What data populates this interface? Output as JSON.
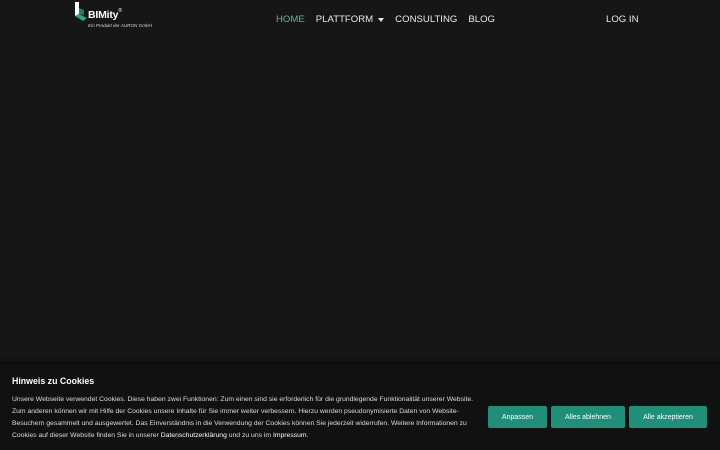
{
  "header": {
    "logo": {
      "name": "BIMity",
      "trademark": "®",
      "tagline": "Ein Produkt der AURON GmbH"
    },
    "nav": [
      {
        "label": "HOME",
        "active": true
      },
      {
        "label": "PLATTFORM",
        "has_dropdown": true
      },
      {
        "label": "CONSULTING"
      },
      {
        "label": "BLOG"
      }
    ],
    "login_label": "LOG IN"
  },
  "cookie_banner": {
    "title": "Hinweis zu Cookies",
    "text_main": "Unsere Webseite verwendet Cookies. Diese haben zwei Funktionen: Zum einen sind sie erforderlich für die grundlegende Funktionalität unserer Website. Zum anderen können wir mit Hilfe der Cookies unsere Inhalte für Sie immer weiter verbessern. Hierzu werden pseudonymisierte Daten von Website-Besuchern gesammelt und ausgewertet. Das Einverständnis in die Verwendung der Cookies können Sie jederzeit widerrufen. Weitere Informationen zu Cookies auf dieser Website finden Sie in unserer ",
    "privacy_link": "Datenschutzerklärung",
    "text_between": " und zu uns im ",
    "imprint_link": "Impressum",
    "text_end": ".",
    "buttons": {
      "customize": "Anpassen",
      "reject": "Alles ablehnen",
      "accept": "Alle akzeptieren"
    }
  },
  "colors": {
    "background": "#161617",
    "accent": "#1f8f79",
    "nav_active": "#5fb3a2"
  }
}
